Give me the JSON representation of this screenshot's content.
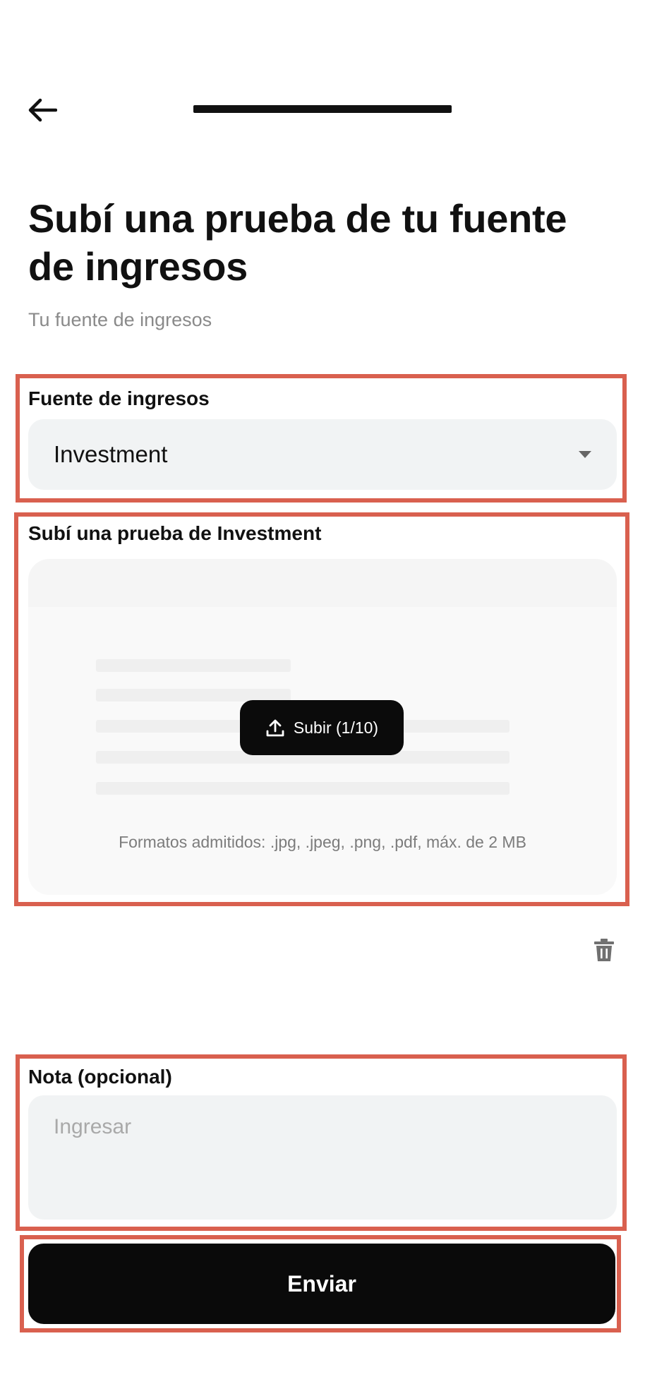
{
  "header": {
    "back_icon": "arrow-left-icon",
    "progress_fraction": 1.0
  },
  "page": {
    "title": "Subí una prueba de tu fuente de ingresos",
    "subtitle": "Tu fuente de ingresos"
  },
  "income_source": {
    "label": "Fuente de ingresos",
    "selected": "Investment",
    "dropdown_icon": "caret-down-icon"
  },
  "proof_upload": {
    "label": "Subí una prueba de Investment",
    "upload_button_label": "Subir (1/10)",
    "upload_icon": "upload-icon",
    "formats_text": "Formatos admitidos: .jpg, .jpeg, .png, .pdf, máx. de 2 MB",
    "delete_icon": "trash-icon"
  },
  "note": {
    "label": "Nota (opcional)",
    "placeholder": "Ingresar",
    "value": ""
  },
  "submit": {
    "label": "Enviar"
  },
  "colors": {
    "highlight": "#d9604f",
    "field_bg": "#f1f3f4",
    "primary_button": "#0a0a0a"
  }
}
